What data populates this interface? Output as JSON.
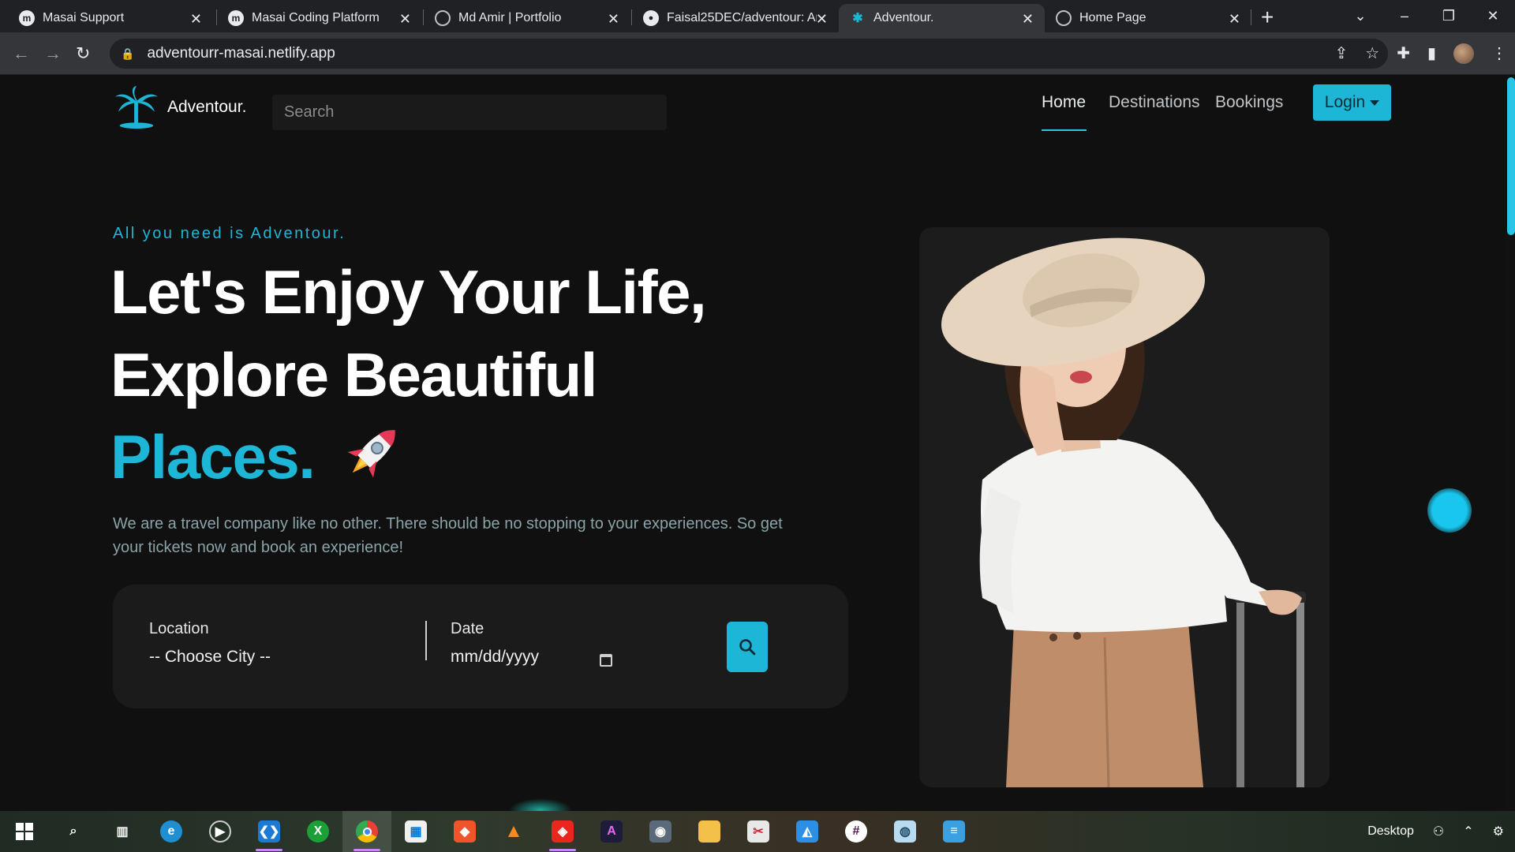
{
  "browser": {
    "tabs": [
      {
        "title": "Masai Support",
        "icon": "masai-icon"
      },
      {
        "title": "Masai Coding Platform",
        "icon": "masai-icon"
      },
      {
        "title": "Md Amir | Portfolio",
        "icon": "globe-icon"
      },
      {
        "title": "Faisal25DEC/adventour: An",
        "icon": "github-icon"
      },
      {
        "title": "Adventour.",
        "icon": "palm-icon"
      },
      {
        "title": "Home Page",
        "icon": "globe-icon"
      }
    ],
    "url": "adventourr-masai.netlify.app"
  },
  "site": {
    "brand": "Adventour.",
    "search_placeholder": "Search",
    "nav": {
      "home": "Home",
      "destinations": "Destinations",
      "bookings": "Bookings",
      "login": "Login"
    },
    "hero": {
      "tagline": "All you need is Adventour.",
      "line1": "Let's Enjoy Your Life,",
      "line2": "Explore Beautiful",
      "line3": "Places.",
      "description": "We are a travel company like no other. There should be no stopping to your experiences. So get your tickets now and book an experience!"
    },
    "booking": {
      "location_label": "Location",
      "location_value": "-- Choose City --",
      "date_label": "Date",
      "date_value": "mm/dd/yyyy"
    }
  },
  "taskbar": {
    "desktop_label": "Desktop",
    "accent": "#c78af5"
  },
  "colors": {
    "accent": "#1eb6d6",
    "background": "#101010"
  }
}
